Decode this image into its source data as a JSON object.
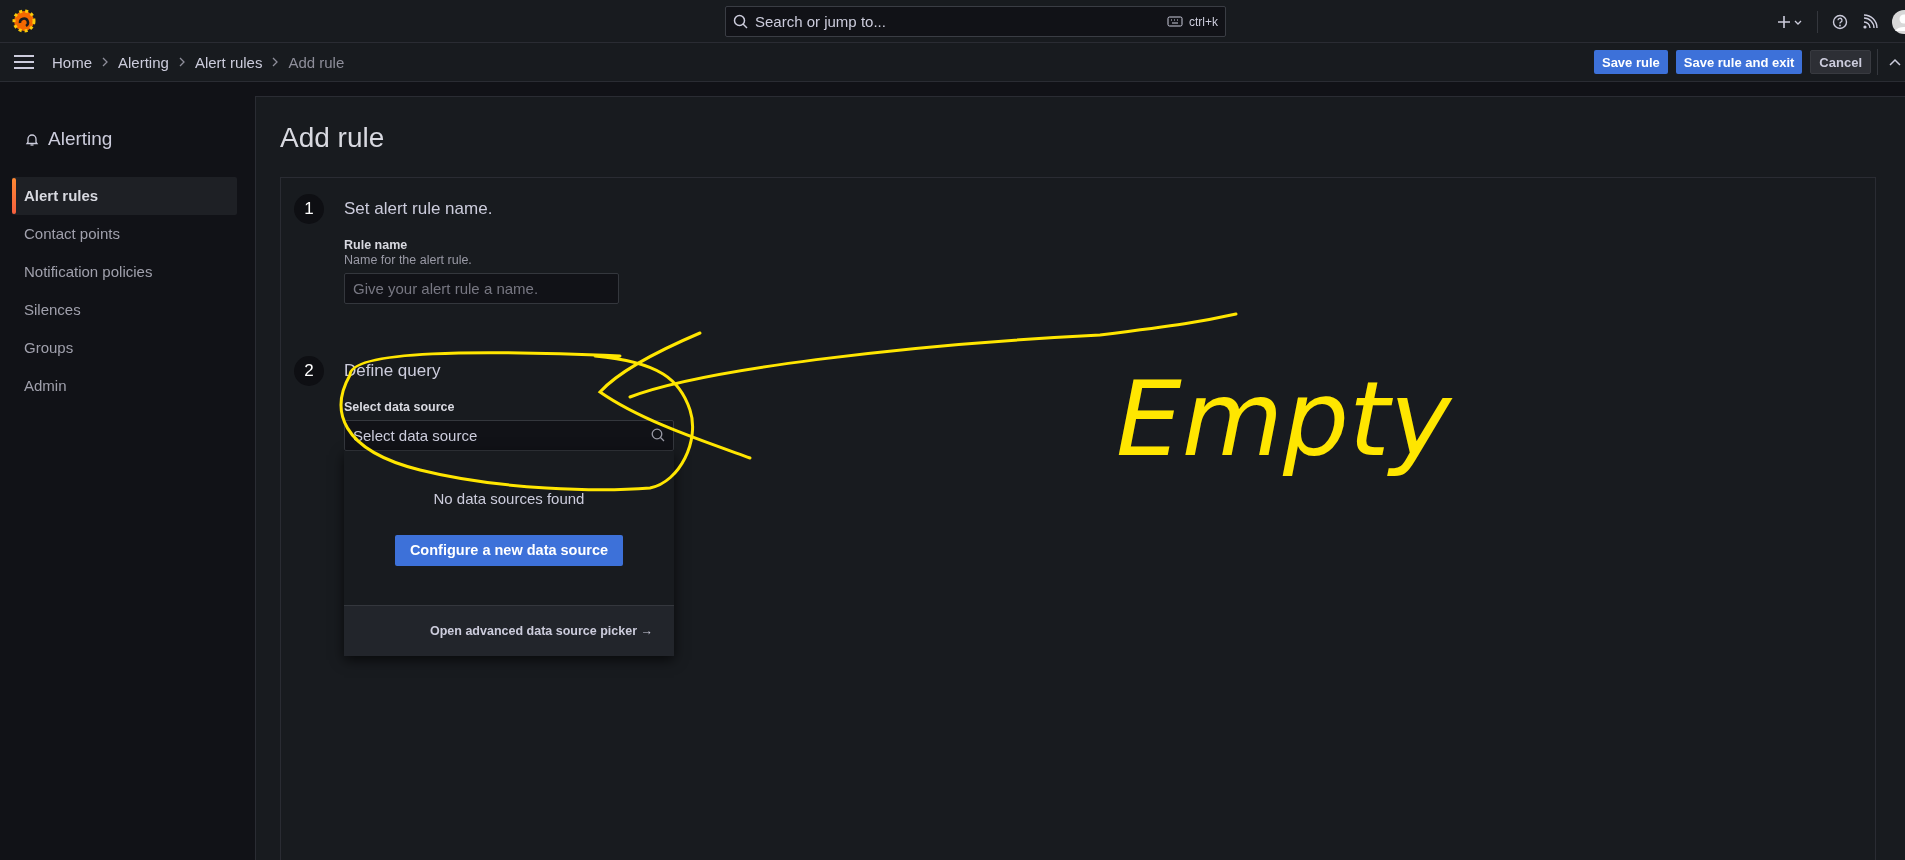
{
  "top_bar": {
    "search": {
      "placeholder": "Search or jump to...",
      "shortcut": "ctrl+k"
    }
  },
  "breadcrumbs": [
    {
      "label": "Home",
      "current": false
    },
    {
      "label": "Alerting",
      "current": false
    },
    {
      "label": "Alert rules",
      "current": false
    },
    {
      "label": "Add rule",
      "current": true
    }
  ],
  "actions": [
    {
      "label": "Save rule",
      "kind": "primary"
    },
    {
      "label": "Save rule and exit",
      "kind": "primary"
    },
    {
      "label": "Cancel",
      "kind": "secondary"
    }
  ],
  "sidebar": {
    "title": "Alerting",
    "items": [
      {
        "label": "Alert rules",
        "selected": true
      },
      {
        "label": "Contact points",
        "selected": false
      },
      {
        "label": "Notification policies",
        "selected": false
      },
      {
        "label": "Silences",
        "selected": false
      },
      {
        "label": "Groups",
        "selected": false
      },
      {
        "label": "Admin",
        "selected": false
      }
    ]
  },
  "page": {
    "title": "Add rule",
    "steps": [
      {
        "number": "1",
        "title": "Set alert rule name.",
        "field": {
          "label": "Rule name",
          "description": "Name for the alert rule.",
          "placeholder": "Give your alert rule a name.",
          "kind": "text"
        }
      },
      {
        "number": "2",
        "title": "Define query",
        "field": {
          "label": "Select data source",
          "placeholder": "Select data source",
          "kind": "picker"
        }
      }
    ]
  },
  "dropdown": {
    "message": "No data sources found",
    "button": "Configure a new data source",
    "footer_link": "Open advanced data source picker →"
  },
  "annotation": {
    "text": "Empty"
  }
}
